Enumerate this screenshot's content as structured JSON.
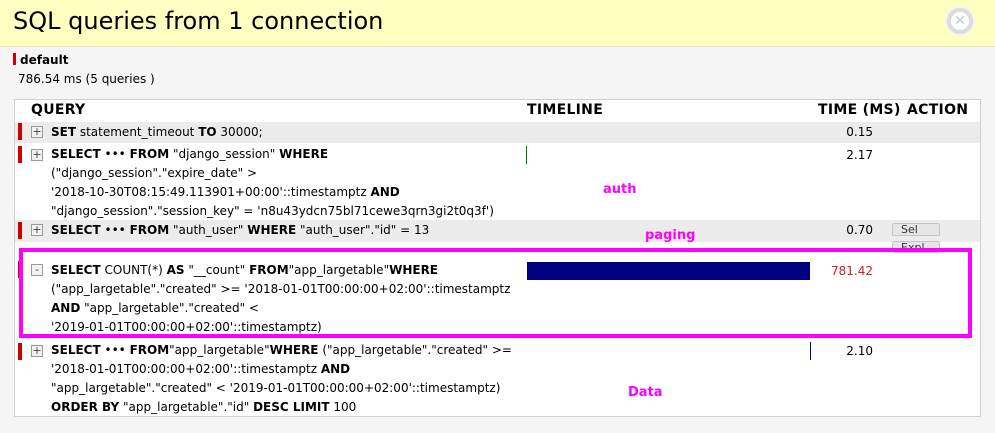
{
  "header": {
    "title": "SQL queries from 1 connection"
  },
  "connection": {
    "name": "default",
    "stats": "786.54 ms (5 queries )"
  },
  "columns": {
    "query": "QUERY",
    "timeline": "TIMELINE",
    "time": "TIME (MS)",
    "action": "ACTION"
  },
  "queries": [
    {
      "toggle": "+",
      "lines": [
        "<b>SET</b> statement_timeout <b>TO</b> 30000;"
      ],
      "time": "0.15",
      "timeline_fraction": 0.0
    },
    {
      "toggle": "+",
      "lines": [
        "<b>SELECT</b> ••• <b>FROM</b> \"django_session\" <b>WHERE</b>",
        "(\"django_session\".\"expire_date\" >",
        "'2018-10-30T08:15:49.113901+00:00'::timestamptz <b>AND</b>",
        "\"django_session\".\"session_key\" = 'n8u43ydcn75bl71cewe3qrn3gi2t0q3f')"
      ],
      "time": "2.17",
      "timeline_fraction": 0.0
    },
    {
      "toggle": "+",
      "lines": [
        "<b>SELECT</b> ••• <b>FROM</b> \"auth_user\" <b>WHERE</b> \"auth_user\".\"id\" = 13"
      ],
      "time": "0.70",
      "timeline_fraction": 0.0,
      "actions": [
        "Sel",
        "Expl"
      ]
    },
    {
      "toggle": "-",
      "lines": [
        "<b>SELECT</b> COUNT(*) <b>AS</b> \"__count\" <b>FROM</b>\"app_largetable\"<b>WHERE</b>",
        "(\"app_largetable\".\"created\" >= '2018-01-01T00:00:00+02:00'::timestamptz",
        "<b>AND</b> \"app_largetable\".\"created\" <",
        "'2019-01-01T00:00:00+02:00'::timestamptz)"
      ],
      "time": "781.42",
      "timeline_fraction": 0.9935
    },
    {
      "toggle": "+",
      "lines": [
        "<b>SELECT</b> ••• <b>FROM</b>\"app_largetable\"<b>WHERE</b> (\"app_largetable\".\"created\" >=",
        "'2018-01-01T00:00:00+02:00'::timestamptz <b>AND</b>",
        "\"app_largetable\".\"created\" < '2019-01-01T00:00:00+02:00'::timestamptz)",
        "<b>ORDER BY</b> \"app_largetable\".\"id\" <b>DESC LIMIT</b> 100"
      ],
      "time": "2.10",
      "timeline_fraction": 0.0
    }
  ],
  "annotations": {
    "auth": "auth",
    "paging": "paging",
    "data": "Data"
  },
  "colors": {
    "slow_time": "#cc2222",
    "timeline_bar": "#000080",
    "highlight": "#ff00ff",
    "row_marker": "#cc0000",
    "header_bg": "#ffffc2"
  }
}
